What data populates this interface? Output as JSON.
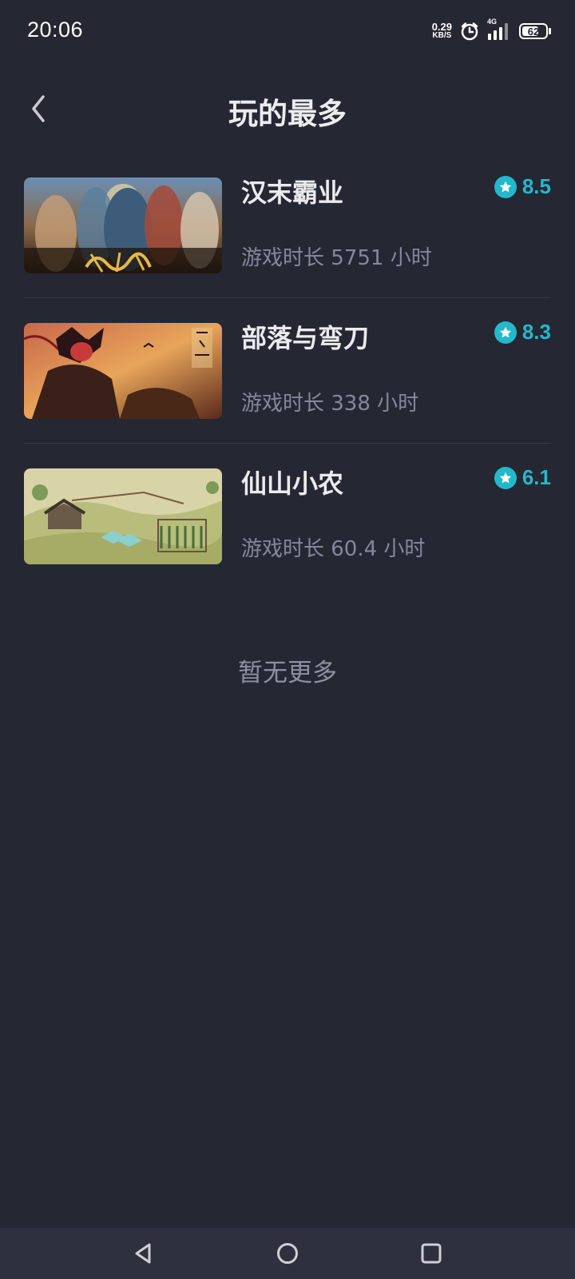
{
  "status_bar": {
    "time": "20:06",
    "net_speed_value": "0.29",
    "net_speed_unit": "KB/S",
    "network_type": "4G",
    "battery_level": "62",
    "icons": [
      "alarm-icon",
      "signal-icon",
      "battery-icon"
    ]
  },
  "header": {
    "title": "玩的最多",
    "back_icon": "chevron-left-icon"
  },
  "games": [
    {
      "name": "汉末霸业",
      "rating": "8.5",
      "playtime": "游戏时长 5751 小时"
    },
    {
      "name": "部落与弯刀",
      "rating": "8.3",
      "playtime": "游戏时长 338 小时"
    },
    {
      "name": "仙山小农",
      "rating": "6.1",
      "playtime": "游戏时长 60.4 小时"
    }
  ],
  "footer_text": "暂无更多",
  "nav_bar": {
    "icons": [
      "nav-back-icon",
      "nav-home-icon",
      "nav-recents-icon"
    ]
  },
  "colors": {
    "background": "#252733",
    "accent": "#23b8cc",
    "secondary_text": "#85889a",
    "nav_bar": "#2e313d"
  }
}
